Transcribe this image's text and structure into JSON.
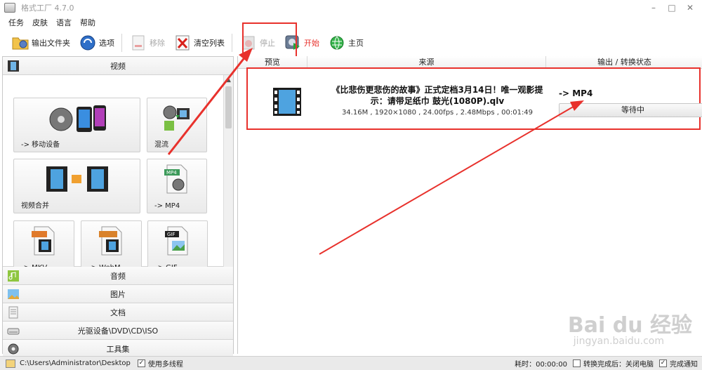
{
  "window": {
    "title": "格式工厂 4.7.0"
  },
  "menu": [
    "任务",
    "皮肤",
    "语言",
    "帮助"
  ],
  "toolbar": {
    "output_folder": "输出文件夹",
    "options": "选项",
    "remove": "移除",
    "clear_list": "清空列表",
    "stop": "停止",
    "start": "开始",
    "home": "主页"
  },
  "left": {
    "video_category": "视频",
    "tiles": {
      "mobile": "-> 移动设备",
      "mix": "混流",
      "merge": "视频合并",
      "mp4": "-> MP4",
      "mkv": "-> MKV",
      "webm": "-> WebM",
      "gif": "-> GIF"
    },
    "categories": [
      "音频",
      "图片",
      "文档",
      "光驱设备\\DVD\\CD\\ISO",
      "工具集"
    ]
  },
  "right": {
    "columns": {
      "preview": "预览",
      "source": "来源",
      "output": "输出 / 转换状态"
    },
    "job": {
      "name": "《比悲伤更悲伤的故事》正式定档3月14日！唯一观影提示：请带足纸巾 鼓光(1080P).qlv",
      "info": "34.16M , 1920×1080 , 24.00fps , 2.48Mbps , 00:01:49",
      "output": "-> MP4",
      "status": "等待中"
    }
  },
  "status": {
    "path": "C:\\Users\\Administrator\\Desktop",
    "multithread": "使用多线程",
    "elapsed": "耗时：00:00:00",
    "after_done": "转换完成后：关闭电脑",
    "notify": "完成通知"
  },
  "watermark": {
    "brand": "Bai du 经验",
    "url": "jingyan.baidu.com"
  },
  "colors": {
    "highlight": "#e8312c",
    "start_text": "#e8312c"
  }
}
